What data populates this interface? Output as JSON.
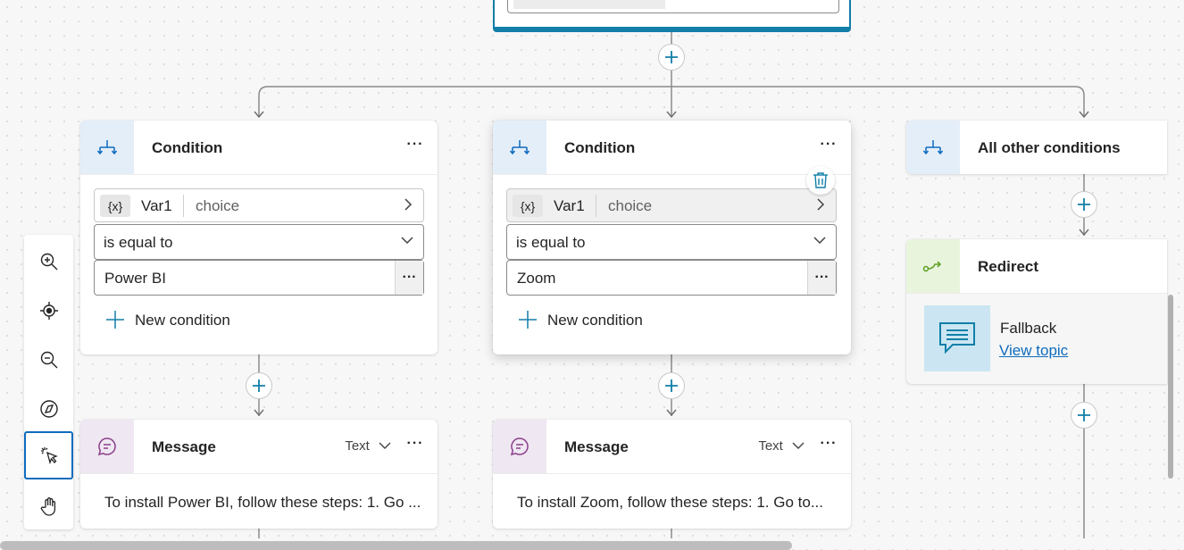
{
  "colors": {
    "accent": "#0f6cbd",
    "teal": "#117fa8",
    "condition_tile": "#e4eef9",
    "message_tile": "#efe7f1",
    "redirect_tile": "#e9f4dd",
    "fallback_tile": "#cbe6f2"
  },
  "branches": [
    {
      "title": "Condition",
      "variable": {
        "badge": "{x}",
        "name": "Var1",
        "type": "choice"
      },
      "operator": "is equal to",
      "value": "Power BI",
      "new_condition": "New condition",
      "message": {
        "title": "Message",
        "type": "Text",
        "text": "To install Power BI, follow these steps: 1. Go ..."
      }
    },
    {
      "title": "Condition",
      "variable": {
        "badge": "{x}",
        "name": "Var1",
        "type": "choice"
      },
      "operator": "is equal to",
      "value": "Zoom",
      "new_condition": "New condition",
      "message": {
        "title": "Message",
        "type": "Text",
        "text": "To install Zoom, follow these steps: 1. Go to..."
      }
    }
  ],
  "other": {
    "title": "All other conditions",
    "redirect": {
      "title": "Redirect",
      "topic": "Fallback",
      "link": "View topic"
    }
  },
  "toolbar": [
    "zoom-in-icon",
    "locate-icon",
    "zoom-out-icon",
    "minimap-icon",
    "select-pointer-icon",
    "pan-hand-icon"
  ]
}
